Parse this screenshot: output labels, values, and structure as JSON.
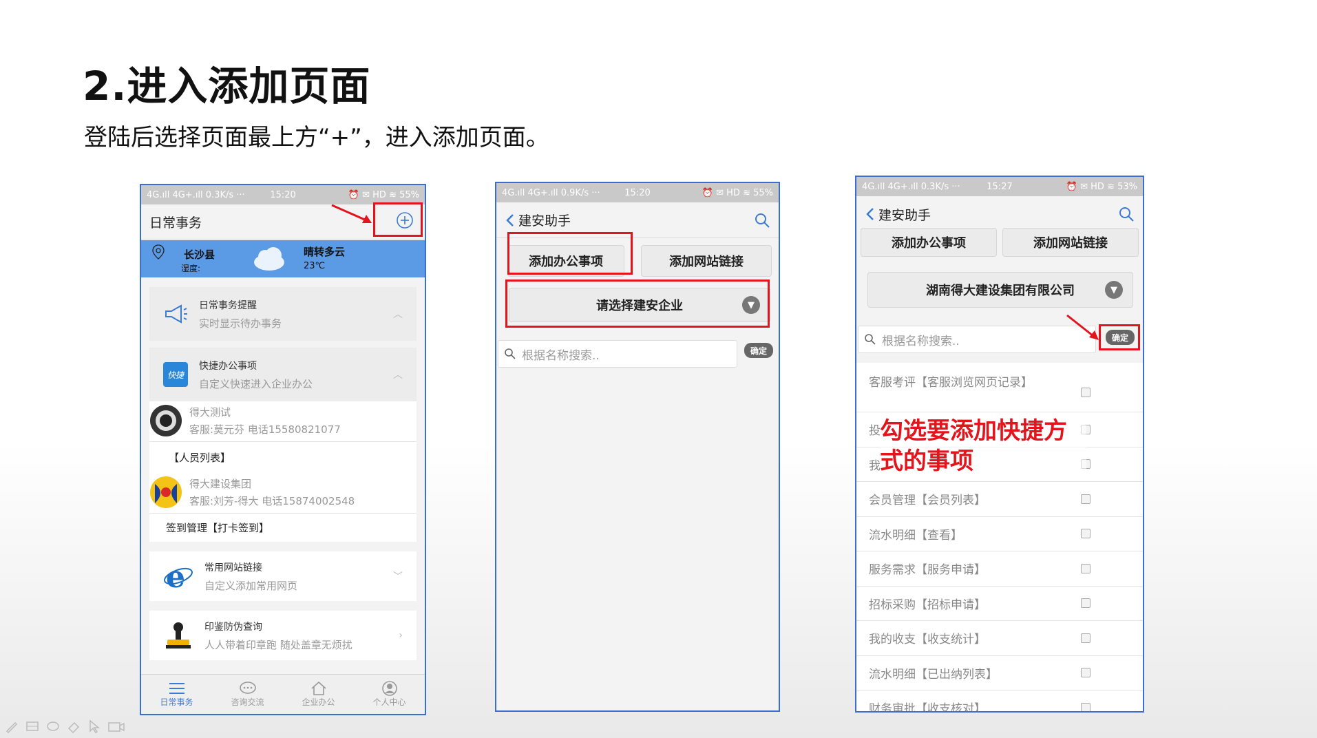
{
  "slide": {
    "title": "2.进入添加页面",
    "subtitle": "登陆后选择页面最上方“+”，进入添加页面。"
  },
  "phone1": {
    "status": {
      "left": "4G.ıll 4G+.ıll 0.3K/s ···",
      "time": "15:20",
      "right": "⏰ ✉ HD ≋ 55%"
    },
    "nav_title": "日常事务",
    "weather": {
      "location": "长沙县",
      "humidity_label": "湿度:",
      "condition": "晴转多云",
      "temperature": "23℃"
    },
    "reminder": {
      "title": "日常事务提醒",
      "subtitle": "实时显示待办事务"
    },
    "quick": {
      "title": "快捷办公事项",
      "subtitle": "自定义快速进入企业办公",
      "badge": "快捷",
      "items": [
        {
          "name": "得大测试",
          "detail": "客服:莫元芬 电话15580821077"
        },
        {
          "name": "【人员列表】"
        },
        {
          "name": "得大建设集团",
          "detail": "客服:刘芳-得大 电话15874002548"
        },
        {
          "name": "签到管理【打卡签到】"
        }
      ]
    },
    "links": {
      "title": "常用网站链接",
      "subtitle": "自定义添加常用网页"
    },
    "seal": {
      "title": "印鉴防伪查询",
      "subtitle": "人人带着印章跑 随处盖章无烦扰"
    },
    "tabs": [
      {
        "label": "日常事务",
        "icon": "menu-icon"
      },
      {
        "label": "咨询交流",
        "icon": "chat-icon"
      },
      {
        "label": "企业办公",
        "icon": "home-icon"
      },
      {
        "label": "个人中心",
        "icon": "user-icon"
      }
    ]
  },
  "phone2": {
    "status": {
      "left": "4G.ıll 4G+.ıll 0.9K/s ···",
      "time": "15:20",
      "right": "⏰ ✉ HD ≋ 55%"
    },
    "nav_title": "建安助手",
    "btn_add_office": "添加办公事项",
    "btn_add_link": "添加网站链接",
    "select_placeholder": "请选择建安企业",
    "search_placeholder": "根据名称搜索..",
    "confirm": "确定"
  },
  "phone3": {
    "status": {
      "left": "4G.ıll 4G+.ıll 0.3K/s ···",
      "time": "15:27",
      "right": "⏰ ✉ HD ≋ 53%"
    },
    "nav_title": "建安助手",
    "btn_add_office": "添加办公事项",
    "btn_add_link": "添加网站链接",
    "selected_company": "湖南得大建设集团有限公司",
    "search_placeholder": "根据名称搜索..",
    "confirm": "确定",
    "annotation": "勾选要添加快捷方式的事项",
    "items": [
      "客服考评【客服浏览网页记录】",
      "投",
      "我",
      "会员管理【会员列表】",
      "流水明细【查看】",
      "服务需求【服务申请】",
      "招标采购【招标申请】",
      "我的收支【收支统计】",
      "流水明细【已出纳列表】",
      "财务审批【收支核对】"
    ]
  }
}
